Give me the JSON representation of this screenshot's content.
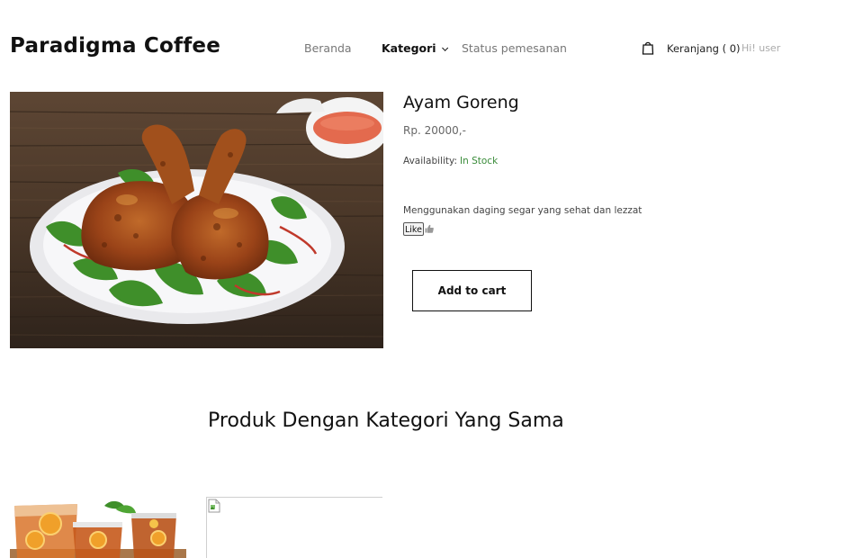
{
  "header": {
    "brand": "Paradigma Coffee",
    "nav": [
      {
        "label": "Beranda"
      },
      {
        "label": "Kategori"
      },
      {
        "label": "Status pemesanan"
      }
    ],
    "cart": {
      "label": "Keranjang ( 0)",
      "greeting": "Hi! user"
    }
  },
  "product": {
    "name": "Ayam Goreng",
    "price": "Rp. 20000,-",
    "availability_label": "Availability:",
    "availability_value": "In Stock",
    "description": "Menggunakan daging segar yang sehat dan lezzat",
    "like_label": "Like",
    "add_to_cart_label": "Add to cart",
    "image_icon": "fried-chicken-photo"
  },
  "related": {
    "title": "Produk Dengan Kategori Yang Sama",
    "items": [
      {
        "image_icon": "iced-tea-photo"
      },
      {
        "image_icon": "broken-image-icon"
      }
    ]
  },
  "colors": {
    "in_stock": "#3a8c3a",
    "nav_inactive": "#777777",
    "greeting": "#aaaaaa"
  }
}
